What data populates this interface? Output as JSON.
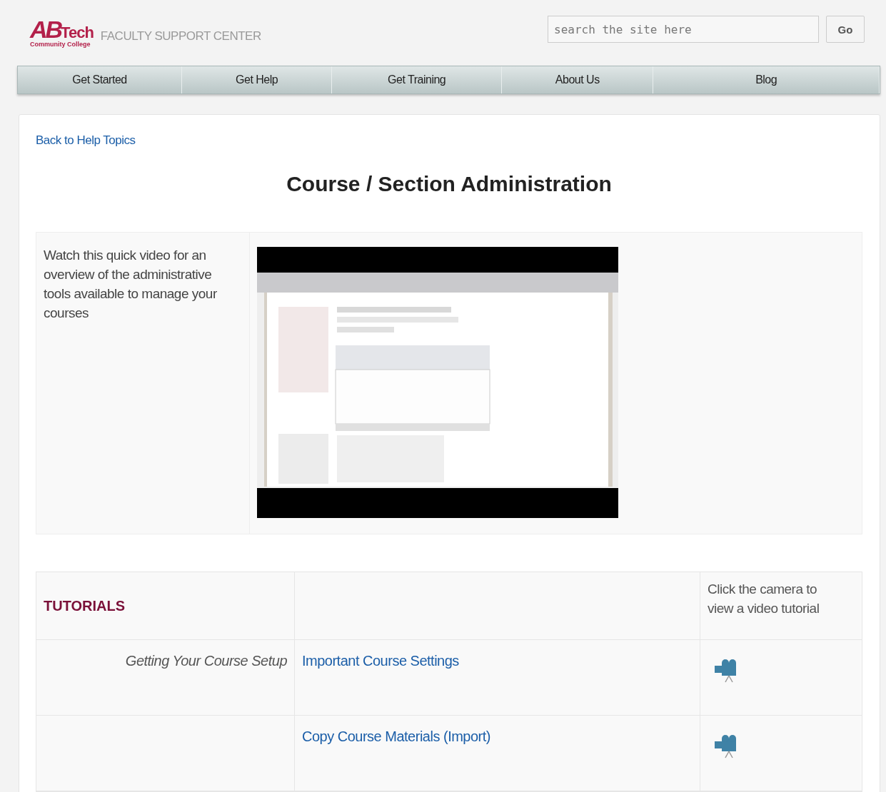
{
  "header": {
    "logo": {
      "mark": "AB",
      "word": "Tech",
      "tagline": "Community College"
    },
    "site_name": "FACULTY SUPPORT CENTER",
    "search": {
      "placeholder": "search the site here"
    },
    "go_button": "Go"
  },
  "nav": [
    "Get Started",
    "Get Help",
    "Get Training",
    "About Us",
    "Blog"
  ],
  "back_link": "Back to Help Topics",
  "title": "Course / Section Administration",
  "intro": {
    "text": "Watch this quick video for an overview of the administrative tools available to manage your courses"
  },
  "tutorials": {
    "heading": "TUTORIALS",
    "note": "Click the camera to view a video tutorial",
    "rows": [
      {
        "section": "Getting Your Course Setup",
        "link": "Important Course Settings"
      },
      {
        "link": "Copy Course Materials (Import)"
      }
    ]
  }
}
